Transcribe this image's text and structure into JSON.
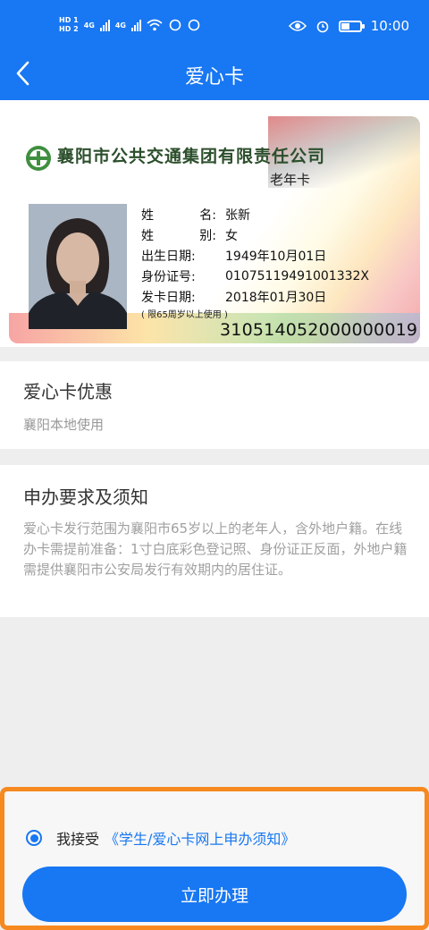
{
  "status_bar": {
    "hd1": "HD 1",
    "hd2": "HD 2",
    "net1": "4G",
    "net2": "4G",
    "time": "10:00",
    "icons": [
      "signal-icon",
      "wifi-icon",
      "eye-icon",
      "alarm-icon",
      "battery-icon"
    ],
    "battery_level": 0.4
  },
  "nav": {
    "title": "爱心卡",
    "back_icon": "chevron-left-icon"
  },
  "card": {
    "company": "襄阳市公共交通集团有限责任公司",
    "type": "老年卡",
    "fields": [
      {
        "label": "姓　　名:",
        "value": "张新"
      },
      {
        "label": "姓　　别:",
        "value": "女"
      },
      {
        "label": "出生日期:",
        "value": "1949年10月01日"
      },
      {
        "label": "身份证号:",
        "value": "01075119491001332X"
      },
      {
        "label": "发卡日期:",
        "value": "2018年01月30日"
      }
    ],
    "note": "( 限65周岁以上使用 )",
    "number": "310514052000000019"
  },
  "benefit": {
    "title": "爱心卡优惠",
    "subtitle": "襄阳本地使用"
  },
  "notice": {
    "title": "申办要求及须知",
    "text": "爱心卡发行范围为襄阳市65岁以上的老年人，含外地户籍。在线办卡需提前准备：1寸白底彩色登记照、身份证正反面，外地户籍需提供襄阳市公安局发行有效期内的居住证。"
  },
  "footer": {
    "agree_text": "我接受",
    "agree_link": "《学生/爱心卡网上申办须知》",
    "agreed": true,
    "submit_label": "立即办理"
  },
  "colors": {
    "primary": "#1877f2",
    "highlight_border": "#f6891f"
  }
}
